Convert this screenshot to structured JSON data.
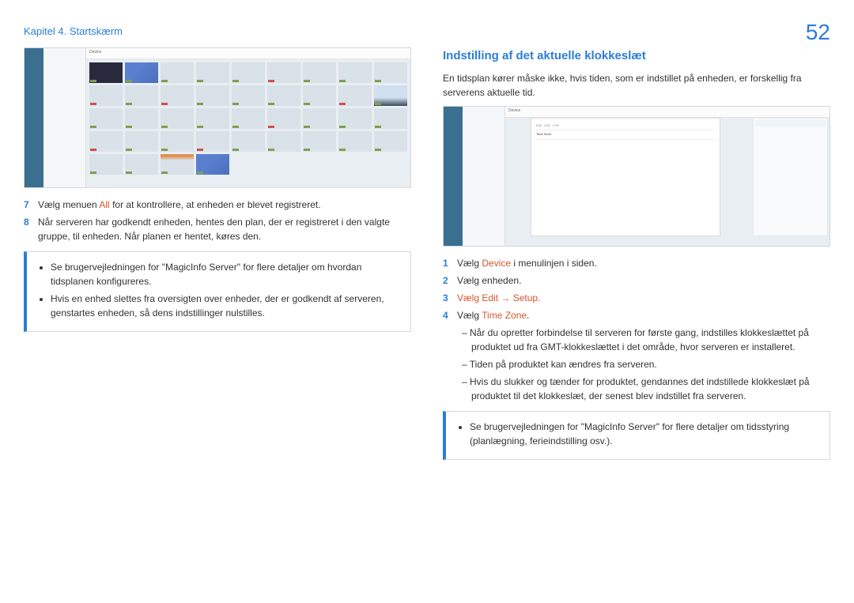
{
  "header": {
    "chapter": "Kapitel 4. Startskærm",
    "page": "52"
  },
  "left": {
    "ss_device_label": "Device",
    "steps": [
      {
        "num": "7",
        "prefix": "Vælg menuen ",
        "hl": "All",
        "suffix": " for at kontrollere, at enheden er blevet registreret."
      },
      {
        "num": "8",
        "text": "Når serveren har godkendt enheden, hentes den plan, der er registreret i den valgte gruppe, til enheden. Når planen er hentet, køres den."
      }
    ],
    "note": [
      "Se brugervejledningen for \"MagicInfo Server\" for flere detaljer om hvordan tidsplanen konfigureres.",
      "Hvis en enhed slettes fra oversigten over enheder, der er godkendt af serveren, genstartes enheden, så dens indstillinger nulstilles."
    ]
  },
  "right": {
    "title": "Indstilling af det aktuelle klokkeslæt",
    "intro": "En tidsplan kører måske ikke, hvis tiden, som er indstillet på enheden, er forskellig fra serverens aktuelle tid.",
    "ss_device_label": "Device",
    "steps": [
      {
        "num": "1",
        "prefix": "Vælg ",
        "hl": "Device",
        "suffix": " i menulinjen i siden."
      },
      {
        "num": "2",
        "text": "Vælg enheden."
      },
      {
        "num": "3",
        "full_hl": true,
        "prefix": "Vælg ",
        "hl": "Edit → Setup",
        "suffix": "."
      },
      {
        "num": "4",
        "prefix": "Vælg ",
        "hl": "Time Zone",
        "suffix": "."
      }
    ],
    "dash": [
      "Når du opretter forbindelse til serveren for første gang, indstilles klokkeslættet på produktet ud fra GMT-klokkeslættet i det område, hvor serveren er installeret.",
      "Tiden på produktet kan ændres fra serveren.",
      "Hvis du slukker og tænder for produktet, gendannes det indstillede klokkeslæt på produktet til det klokkeslæt, der senest blev indstillet fra serveren."
    ],
    "note": [
      "Se brugervejledningen for \"MagicInfo Server\" for flere detaljer om tidsstyring (planlægning, ferieindstilling osv.)."
    ]
  }
}
